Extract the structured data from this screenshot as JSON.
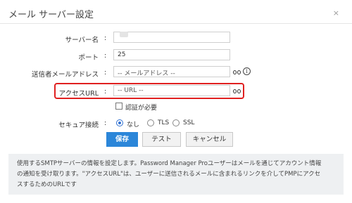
{
  "dialog": {
    "title": "メール サーバー設定",
    "close": "×"
  },
  "form": {
    "colon": ":",
    "server_name": {
      "label": "サーバー名"
    },
    "port": {
      "label": "ポート",
      "value": "25"
    },
    "sender_email": {
      "label": "送信者メールアドレス",
      "placeholder": "-- メールアドレス --",
      "info": "i"
    },
    "access_url": {
      "label": "アクセスURL",
      "placeholder": "-- URL --"
    },
    "auth_required": {
      "label": "認証が必要",
      "checked": false
    },
    "secure_connection": {
      "label": "セキュア接続",
      "options": [
        "なし",
        "TLS",
        "SSL"
      ],
      "selected": "なし"
    }
  },
  "buttons": {
    "save": "保存",
    "test": "テスト",
    "cancel": "キャンセル"
  },
  "note": {
    "line1": "使用するSMTPサーバーの情報を設定します。Password Manager Proユーザーはメールを通じてアカウント情報",
    "line2": "の通知を受け取ります。\"アクセスURL\"は、ユーザーに送信されるメールに含まれるリンクを介してPMPにアクセ",
    "line3": "スするためのURLです"
  },
  "colors": {
    "accent": "#2b86d9",
    "highlight": "#e02020"
  }
}
